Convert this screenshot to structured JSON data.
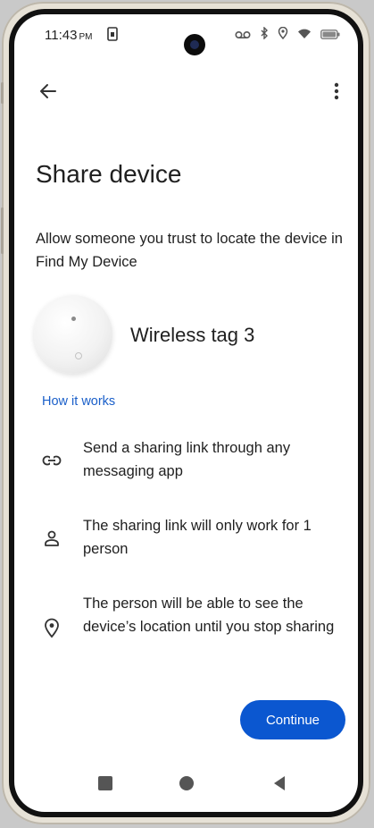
{
  "status_bar": {
    "time": "11:43",
    "time_suffix": "PM",
    "icons": [
      "sim-card-icon",
      "voicemail-icon",
      "bluetooth-icon",
      "location-icon",
      "wifi-icon",
      "battery-icon"
    ]
  },
  "app_bar": {
    "back_icon": "arrow-back-icon",
    "menu_icon": "more-vert-icon"
  },
  "page": {
    "title": "Share device",
    "description": "Allow someone you trust to locate the device in Find My Device"
  },
  "device": {
    "name": "Wireless tag 3"
  },
  "how_it_works_link": "How it works",
  "info_items": [
    {
      "icon": "link-icon",
      "text": "Send a sharing link through any messaging app"
    },
    {
      "icon": "person-icon",
      "text": "The sharing link will only work for 1 person"
    },
    {
      "icon": "location-pin-icon",
      "text": "The person will be able to see the device’s location until you stop sharing"
    }
  ],
  "continue_button": "Continue",
  "colors": {
    "accent": "#0b57d0",
    "link": "#1a5fc9",
    "text": "#1f1f1f"
  }
}
